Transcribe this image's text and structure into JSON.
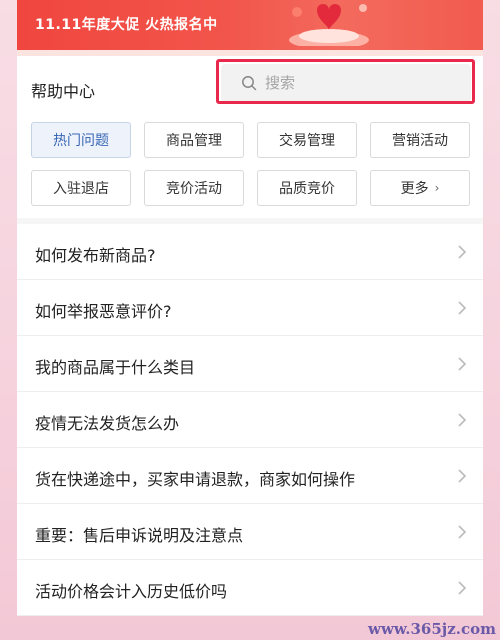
{
  "banner": {
    "text": "11.11年度大促 火热报名中"
  },
  "header": {
    "title": "帮助中心",
    "search_placeholder": "搜索"
  },
  "tags": [
    {
      "label": "热门问题",
      "active": true
    },
    {
      "label": "商品管理"
    },
    {
      "label": "交易管理"
    },
    {
      "label": "营销活动"
    },
    {
      "label": "入驻退店"
    },
    {
      "label": "竞价活动"
    },
    {
      "label": "品质竞价"
    },
    {
      "label": "更多",
      "has_chevron": true
    }
  ],
  "tag_more_chevron": "›",
  "list": [
    {
      "text": "如何发布新商品?"
    },
    {
      "text": "如何举报恶意评价?"
    },
    {
      "text": "我的商品属于什么类目"
    },
    {
      "text": "疫情无法发货怎么办"
    },
    {
      "text": "货在快递途中，买家申请退款，商家如何操作"
    },
    {
      "text": "重要：售后申诉说明及注意点"
    },
    {
      "text": "活动价格会计入历史低价吗"
    }
  ],
  "watermark": "www.365jz.com",
  "colors": {
    "highlight_border": "#e8294b",
    "active_tag_text": "#3a67b5",
    "banner": "#f0463f"
  },
  "icons": {
    "search": "search-icon",
    "arrow": "chevron-right-icon",
    "gift": "gift-icon"
  }
}
